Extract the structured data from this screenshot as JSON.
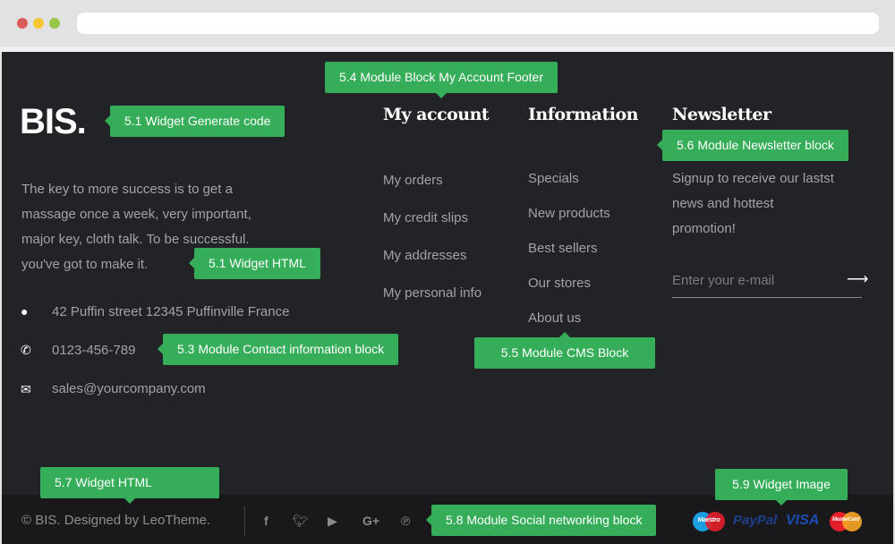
{
  "brand": {
    "logo": "BIS.",
    "description": [
      "The key to more success is to get a",
      "massage once a week, very important,",
      "major key, cloth talk. To be successful.",
      "you've got to make it."
    ]
  },
  "contact": {
    "address": "42 Puffin street 12345 Puffinville France",
    "phone": "0123-456-789",
    "email": "sales@yourcompany.com"
  },
  "my_account": {
    "title": "My account",
    "items": [
      "My orders",
      "My credit slips",
      "My addresses",
      "My personal info"
    ]
  },
  "information": {
    "title": "Information",
    "items": [
      "Specials",
      "New products",
      "Best sellers",
      "Our stores",
      "About us"
    ]
  },
  "newsletter": {
    "title": "Newsletter",
    "text": [
      "Signup to receive our lastst",
      "news and hottest",
      "promotion!"
    ],
    "placeholder": "Enter your e-mail",
    "submit_icon": "arrow-right-icon"
  },
  "footer": {
    "copyright": "© BIS. Designed by LeoTheme.",
    "social": [
      "facebook-icon",
      "twitter-icon",
      "youtube-icon",
      "google-plus-icon",
      "pinterest-icon"
    ],
    "payments": [
      "Maestro",
      "PayPal",
      "VISA",
      "MasterCard"
    ]
  },
  "annotations": {
    "a51": "5.1 Widget Generate code",
    "a51b": "5.1 Widget HTML",
    "a53": "5.3 Module Contact information block",
    "a54": "5.4 Module Block My Account Footer",
    "a55": "5.5 Module CMS Block",
    "a56": "5.6 Module Newsletter block",
    "a57": "5.7 Widget HTML",
    "a58": "5.8 Module Social networking block",
    "a59": "5.9 Widget Image"
  },
  "colors": {
    "accent": "#35ad59",
    "background": "#222327",
    "bottom": "#19191c"
  }
}
